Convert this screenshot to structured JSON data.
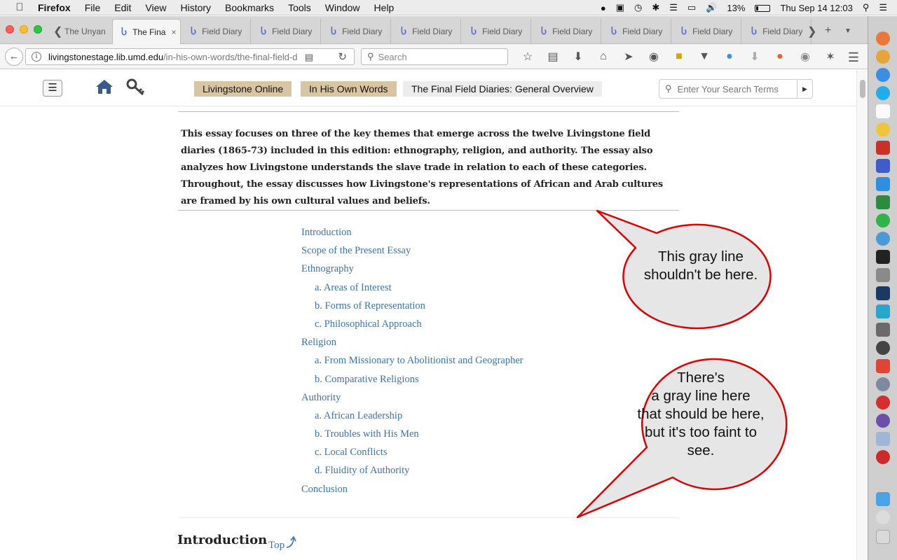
{
  "menubar": {
    "app": "Firefox",
    "items": [
      "File",
      "Edit",
      "View",
      "History",
      "Bookmarks",
      "Tools",
      "Window",
      "Help"
    ],
    "battery": "13%",
    "clock": "Thu Sep 14  12:03"
  },
  "tabs": [
    {
      "label": "The Unyan"
    },
    {
      "label": "The Fina",
      "active": true
    },
    {
      "label": "Field Diary"
    },
    {
      "label": "Field Diary"
    },
    {
      "label": "Field Diary"
    },
    {
      "label": "Field Diary"
    },
    {
      "label": "Field Diary"
    },
    {
      "label": "Field Diary"
    },
    {
      "label": "Field Diary"
    },
    {
      "label": "Field Diary"
    },
    {
      "label": "Field Diary"
    }
  ],
  "tab_close": "×",
  "tab_logo": "Ⴑ",
  "navbar": {
    "url_host": "livingstonestage.lib.umd.edu",
    "url_path": "/in-his-own-words/the-final-field-d",
    "search_placeholder": "Search"
  },
  "site": {
    "breadcrumbs": [
      "Livingstone Online",
      "In His Own Words",
      "The Final Field Diaries: General Overview"
    ],
    "search_placeholder": "Enter Your Search Terms"
  },
  "content": {
    "abstract": "This essay focuses on three of the key themes that emerge across the twelve Livingstone field diaries (1865-73) included in this edition: ethnography, religion, and authority. The essay also analyzes how Livingstone understands the slave trade in relation to each of these categories. Throughout, the essay discusses how Livingstone's representations of African and Arab cultures are framed by his own cultural values and beliefs.",
    "toc": [
      {
        "label": "Introduction",
        "sub": false
      },
      {
        "label": "Scope of the Present Essay",
        "sub": false
      },
      {
        "label": "Ethnography",
        "sub": false
      },
      {
        "label": "a. Areas of Interest",
        "sub": true
      },
      {
        "label": "b. Forms of Representation",
        "sub": true
      },
      {
        "label": "c. Philosophical Approach",
        "sub": true
      },
      {
        "label": "Religion",
        "sub": false
      },
      {
        "label": "a. From Missionary to Abolitionist and Geographer",
        "sub": true
      },
      {
        "label": "b. Comparative Religions",
        "sub": true
      },
      {
        "label": "Authority",
        "sub": false
      },
      {
        "label": "a. African Leadership",
        "sub": true
      },
      {
        "label": "b. Troubles with His Men",
        "sub": true
      },
      {
        "label": "c. Local Conflicts",
        "sub": true
      },
      {
        "label": "d. Fluidity of Authority",
        "sub": true
      },
      {
        "label": "Conclusion",
        "sub": false
      }
    ],
    "section_heading": "Introduction",
    "top_link": "Top"
  },
  "annotations": {
    "bubble1": [
      "This gray line",
      "shouldn't be here."
    ],
    "bubble2": [
      "There's",
      "a gray line here",
      "that should be here,",
      "but it's too faint to",
      "see."
    ]
  },
  "colors": {
    "link": "#3b73ae",
    "breadcrumb_tan": "#d9c5a1",
    "bubble_outline": "#e00000",
    "bubble_fill": "#e6e6e6"
  }
}
